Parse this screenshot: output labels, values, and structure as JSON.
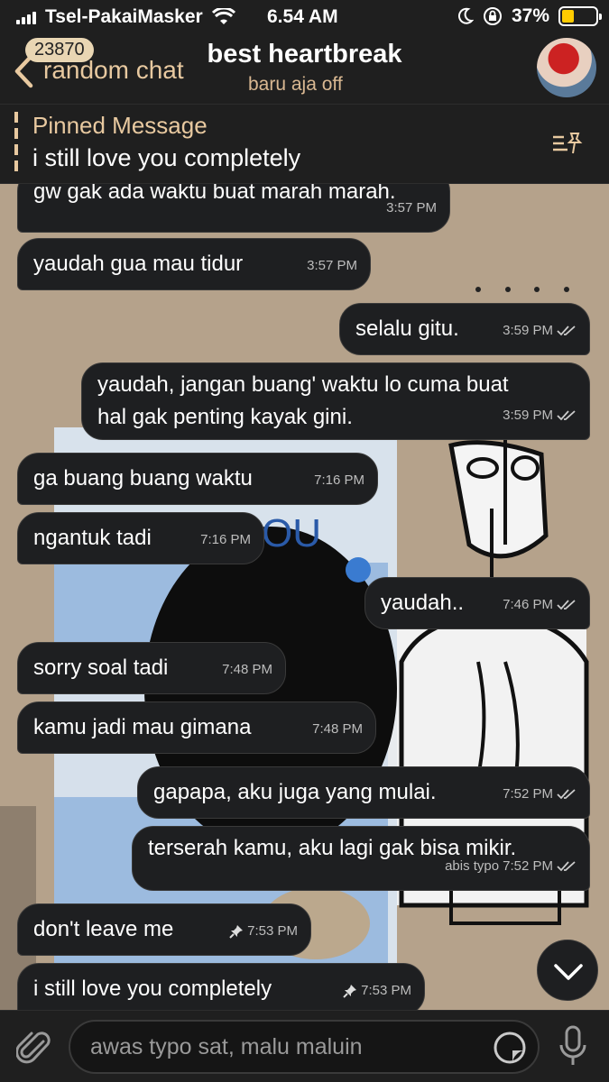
{
  "status_bar": {
    "carrier": "Tsel-PakaiMasker",
    "time": "6.54 AM",
    "battery_percent": "37%",
    "battery_level": 0.37,
    "icons": [
      "signal-icon",
      "wifi-icon",
      "moon-icon",
      "rotation-lock-icon",
      "battery-icon"
    ]
  },
  "header": {
    "back_label": "random chat",
    "unread_badge": "23870",
    "title": "best heartbreak",
    "subtitle": "baru aja off"
  },
  "pinned": {
    "title": "Pinned Message",
    "text": "i still love you completely"
  },
  "messages": [
    {
      "dir": "in",
      "text": "gw gak ada waktu buat marah marah.",
      "time": "3:57 PM"
    },
    {
      "dir": "in",
      "text": "yaudah gua mau tidur",
      "time": "3:57 PM"
    },
    {
      "dir": "out",
      "text": "selalu gitu.",
      "time": "3:59 PM"
    },
    {
      "dir": "out",
      "text": "yaudah, jangan buang' waktu lo cuma buat",
      "text2": "hal gak penting kayak gini.",
      "time": "3:59 PM"
    },
    {
      "dir": "in",
      "text": "ga buang buang waktu",
      "time": "7:16 PM"
    },
    {
      "dir": "in",
      "text": "ngantuk tadi",
      "time": "7:16 PM"
    },
    {
      "dir": "out",
      "text": "yaudah..",
      "time": "7:46 PM"
    },
    {
      "dir": "in",
      "text": "sorry soal tadi",
      "time": "7:48 PM"
    },
    {
      "dir": "in",
      "text": "kamu jadi mau gimana",
      "time": "7:48 PM"
    },
    {
      "dir": "out",
      "text": "gapapa, aku juga yang mulai.",
      "time": "7:52 PM"
    },
    {
      "dir": "out",
      "text": "terserah kamu, aku lagi gak bisa mikir.",
      "edited": "abis typo",
      "time": "7:52 PM"
    },
    {
      "dir": "in",
      "text": "don't leave me",
      "time": "7:53 PM",
      "pinned": true
    },
    {
      "dir": "in",
      "text": "i still love you completely",
      "time": "7:53 PM",
      "pinned": true
    }
  ],
  "input": {
    "placeholder": "awas typo sat, malu maluin"
  },
  "colors": {
    "accent": "#e8c9a0",
    "bubble": "#1e1f21",
    "bar": "#1f1f1f"
  }
}
